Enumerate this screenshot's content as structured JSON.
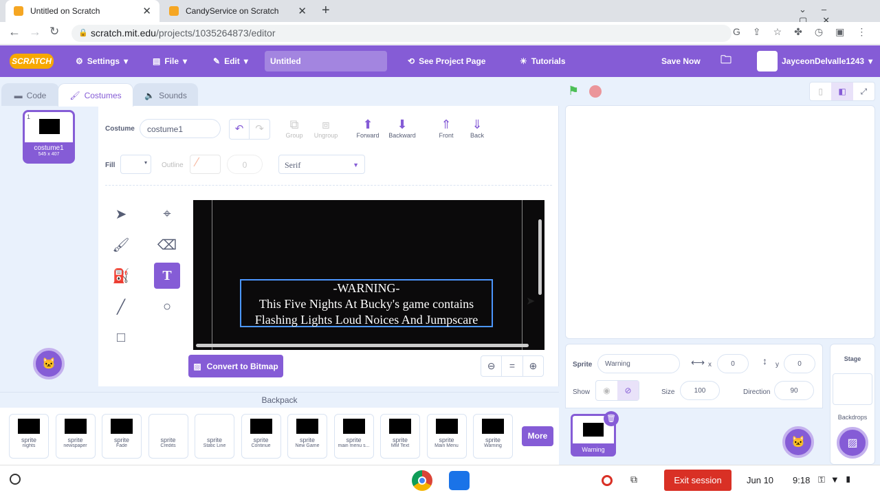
{
  "browser": {
    "tabs": [
      {
        "title": "Untitled on Scratch"
      },
      {
        "title": "CandyService on Scratch"
      }
    ],
    "url_host": "scratch.mit.edu",
    "url_path": "/projects/1035264873/editor"
  },
  "menu": {
    "logo": "SCRATCH",
    "settings": "Settings",
    "file": "File",
    "edit": "Edit",
    "project_title": "Untitled",
    "see_project_page": "See Project Page",
    "tutorials": "Tutorials",
    "save_now": "Save Now",
    "username": "JayceonDelvalle1243"
  },
  "editor_tabs": {
    "code": "Code",
    "costumes": "Costumes",
    "sounds": "Sounds"
  },
  "costume_tile": {
    "index": "1",
    "name": "costume1",
    "size": "545 x 407"
  },
  "paint": {
    "costume_label": "Costume",
    "costume_name": "costume1",
    "group": "Group",
    "ungroup": "Ungroup",
    "forward": "Forward",
    "backward": "Backward",
    "front": "Front",
    "back": "Back",
    "fill": "Fill",
    "outline": "Outline",
    "outline_value": "0",
    "font": "Serif",
    "convert": "Convert to Bitmap",
    "canvas_text": {
      "line1": "-WARNING-",
      "line2": "This Five Nights At Bucky's game contains",
      "line3": "Flashing Lights Loud Noices And Jumpscare"
    }
  },
  "sprite_info": {
    "sprite_label": "Sprite",
    "sprite_name": "Warning",
    "x_label": "x",
    "x": "0",
    "y_label": "y",
    "y": "0",
    "show_label": "Show",
    "size_label": "Size",
    "size": "100",
    "direction_label": "Direction",
    "direction": "90"
  },
  "sprite_list": [
    {
      "name": "Warning"
    }
  ],
  "stage_pane": {
    "title": "Stage",
    "backdrops": "Backdrops"
  },
  "backpack": {
    "title": "Backpack",
    "more": "More",
    "items": [
      {
        "type": "sprite",
        "name": "nights"
      },
      {
        "type": "sprite",
        "name": "newspaper"
      },
      {
        "type": "sprite",
        "name": "Fade"
      },
      {
        "type": "sprite",
        "name": "Credits"
      },
      {
        "type": "sprite",
        "name": "Static Line"
      },
      {
        "type": "sprite",
        "name": "Continue"
      },
      {
        "type": "sprite",
        "name": "New Game"
      },
      {
        "type": "sprite",
        "name": "main menu s..."
      },
      {
        "type": "sprite",
        "name": "MM Text"
      },
      {
        "type": "sprite",
        "name": "Main Menu"
      },
      {
        "type": "sprite",
        "name": "Warning"
      }
    ]
  },
  "shelf": {
    "exit_session": "Exit session",
    "date": "Jun 10",
    "time": "9:18"
  },
  "colors": {
    "accent": "#855cd6",
    "exit": "#d93025"
  }
}
